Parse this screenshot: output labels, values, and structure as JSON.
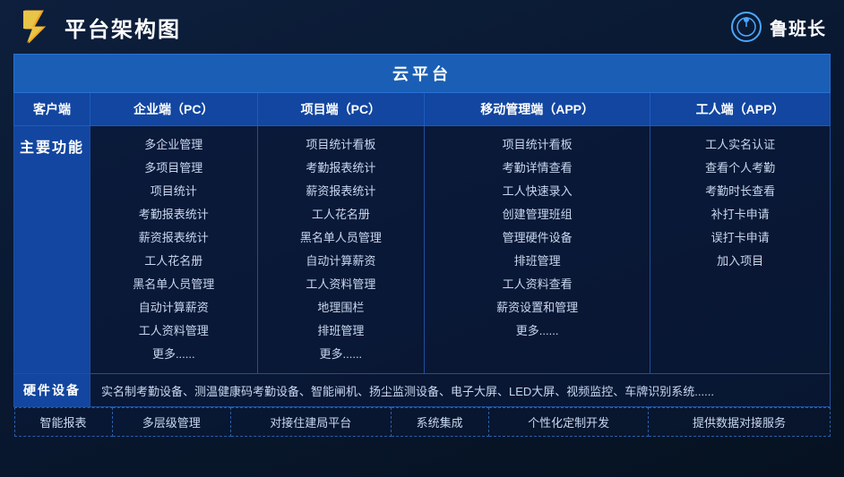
{
  "header": {
    "title": "平台架构图",
    "brand_name": "鲁班长"
  },
  "cloud_platform": {
    "label": "云平台"
  },
  "columns": {
    "client": "客户端",
    "enterprise": "企业端（PC）",
    "project": "项目端（PC）",
    "mobile_mgmt": "移动管理端（APP）",
    "worker": "工人端（APP）"
  },
  "main_function_label": "主要功能",
  "enterprise_features": [
    "多企业管理",
    "多项目管理",
    "项目统计",
    "考勤报表统计",
    "薪资报表统计",
    "工人花名册",
    "黑名单人员管理",
    "自动计算薪资",
    "工人资料管理",
    "更多......"
  ],
  "project_features": [
    "项目统计看板",
    "考勤报表统计",
    "薪资报表统计",
    "工人花名册",
    "黑名单人员管理",
    "自动计算薪资",
    "工人资料管理",
    "地理围栏",
    "排班管理",
    "更多......"
  ],
  "mobile_mgmt_features": [
    "项目统计看板",
    "考勤详情查看",
    "工人快速录入",
    "创建管理班组",
    "管理硬件设备",
    "排班管理",
    "工人资料查看",
    "薪资设置和管理",
    "更多......"
  ],
  "worker_features": [
    "工人实名认证",
    "查看个人考勤",
    "考勤时长查看",
    "补打卡申请",
    "误打卡申请",
    "加入项目"
  ],
  "hardware_label": "硬件设备",
  "hardware_content": "实名制考勤设备、测温健康码考勤设备、智能闸机、扬尘监测设备、电子大屏、LED大屏、视频监控、车牌识别系统......",
  "bottom_features": [
    "智能报表",
    "多层级管理",
    "对接住建局平台",
    "系统集成",
    "个性化定制开发",
    "提供数据对接服务"
  ]
}
